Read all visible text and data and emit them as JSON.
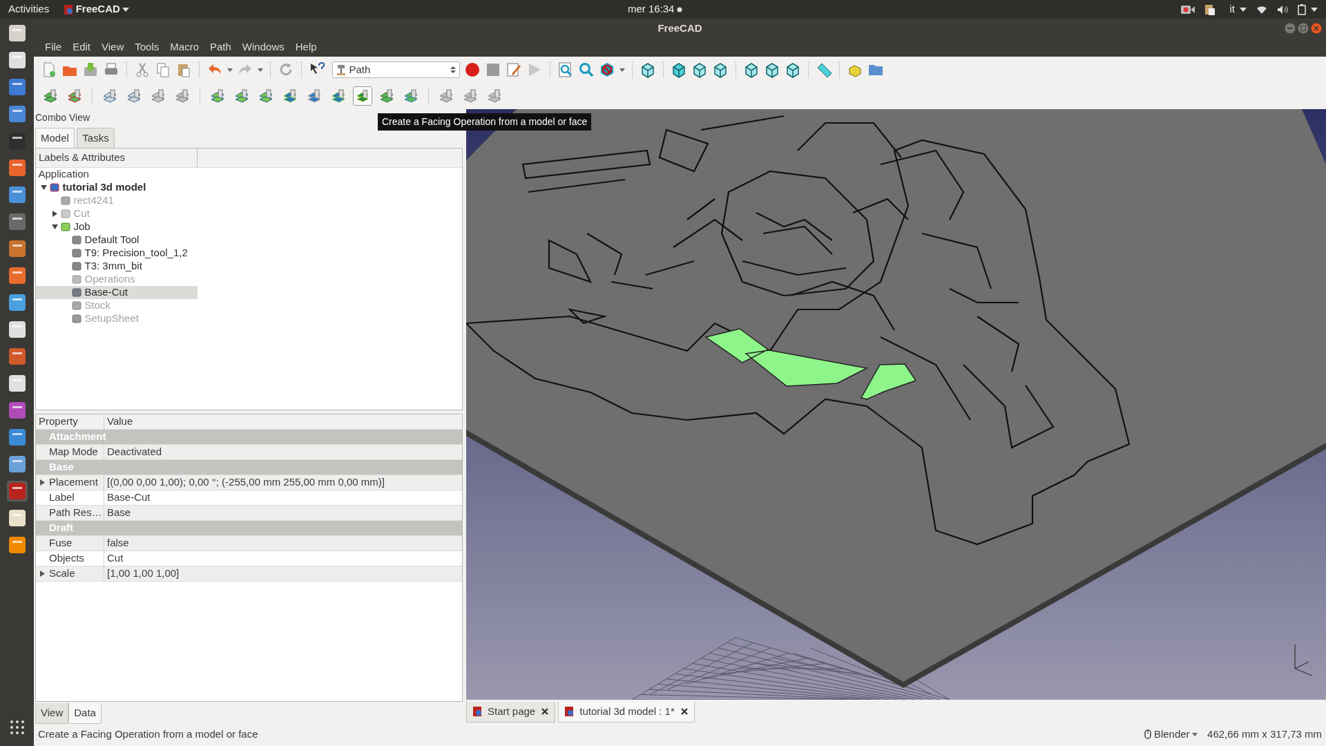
{
  "topbar": {
    "activities": "Activities",
    "app": "FreeCAD",
    "clock": "mer 16:34",
    "language": "it"
  },
  "window": {
    "title": "FreeCAD"
  },
  "menu": [
    "File",
    "Edit",
    "View",
    "Tools",
    "Macro",
    "Path",
    "Windows",
    "Help"
  ],
  "workbench": {
    "value": "Path"
  },
  "path_tools": [
    {
      "kind": "job",
      "hovered": false
    },
    {
      "kind": "export",
      "hovered": false
    },
    {
      "kind": "inspect",
      "hovered": false
    },
    {
      "kind": "simulate",
      "hovered": false
    },
    {
      "kind": "tools",
      "hovered": false
    },
    {
      "kind": "stock",
      "hovered": false
    },
    {
      "kind": "profile",
      "hovered": false
    },
    {
      "kind": "profile",
      "hovered": false
    },
    {
      "kind": "profile",
      "hovered": false
    },
    {
      "kind": "contour",
      "hovered": false
    },
    {
      "kind": "drill",
      "hovered": false
    },
    {
      "kind": "pocket",
      "hovered": false
    },
    {
      "kind": "facing",
      "hovered": true
    },
    {
      "kind": "helix",
      "hovered": false
    },
    {
      "kind": "adaptive",
      "hovered": false
    },
    {
      "kind": "dressup",
      "hovered": false
    },
    {
      "kind": "dressup",
      "hovered": false
    },
    {
      "kind": "dressup",
      "hovered": false
    }
  ],
  "tooltip": "Create a Facing Operation from a model or face",
  "combo_view": {
    "title": "Combo View",
    "tabs": [
      {
        "label": "Model",
        "selected": true
      },
      {
        "label": "Tasks",
        "selected": false
      }
    ],
    "tree": {
      "header": "Labels & Attributes",
      "root": "Application",
      "items": [
        {
          "label": "tutorial 3d model",
          "kind": "document",
          "expanded": true,
          "hidden": false,
          "selected": false,
          "children": [
            {
              "label": "rect4241",
              "kind": "solid",
              "hidden": true,
              "selected": false
            },
            {
              "label": "Cut",
              "kind": "boolean",
              "expanded": false,
              "hidden": true,
              "selected": false
            },
            {
              "label": "Job",
              "kind": "job",
              "expanded": true,
              "hidden": false,
              "selected": false,
              "children": [
                {
                  "label": "Default Tool",
                  "kind": "tool",
                  "hidden": false,
                  "selected": false
                },
                {
                  "label": "T9: Precision_tool_1,2",
                  "kind": "tool",
                  "hidden": false,
                  "selected": false
                },
                {
                  "label": "T3: 3mm_bit",
                  "kind": "tool",
                  "hidden": false,
                  "selected": false
                },
                {
                  "label": "Operations",
                  "kind": "operations",
                  "hidden": true,
                  "selected": false
                },
                {
                  "label": "Base-Cut",
                  "kind": "base",
                  "hidden": false,
                  "selected": true
                },
                {
                  "label": "Stock",
                  "kind": "solid",
                  "hidden": true,
                  "selected": false
                },
                {
                  "label": "SetupSheet",
                  "kind": "sheet",
                  "hidden": true,
                  "selected": false
                }
              ]
            }
          ]
        }
      ]
    }
  },
  "properties": {
    "columns": [
      "Property",
      "Value"
    ],
    "groups": [
      {
        "name": "Attachment",
        "rows": [
          {
            "name": "Map Mode",
            "value": "Deactivated"
          }
        ]
      },
      {
        "name": "Base",
        "rows": [
          {
            "name": "Placement",
            "value": "[(0,00 0,00 1,00); 0,00 °; (-255,00 mm  255,00 mm  0,00 mm)]",
            "expanded": false
          },
          {
            "name": "Label",
            "value": "Base-Cut"
          },
          {
            "name": "Path Res…",
            "value": "Base"
          }
        ]
      },
      {
        "name": "Draft",
        "rows": [
          {
            "name": "Fuse",
            "value": "false"
          },
          {
            "name": "Objects",
            "value": "Cut"
          },
          {
            "name": "Scale",
            "value": "[1,00 1,00 1,00]",
            "expanded": false
          }
        ]
      }
    ]
  },
  "panel_tabs": [
    {
      "label": "View",
      "selected": false
    },
    {
      "label": "Data",
      "selected": true
    }
  ],
  "doc_tabs": [
    {
      "label": "Start page",
      "selected": false
    },
    {
      "label": "tutorial 3d model : 1*",
      "selected": true
    }
  ],
  "status_bar": {
    "message": "Create a Facing Operation from a model or face",
    "navigation": "Blender",
    "dimensions": "462,66 mm x 317,73 mm"
  }
}
